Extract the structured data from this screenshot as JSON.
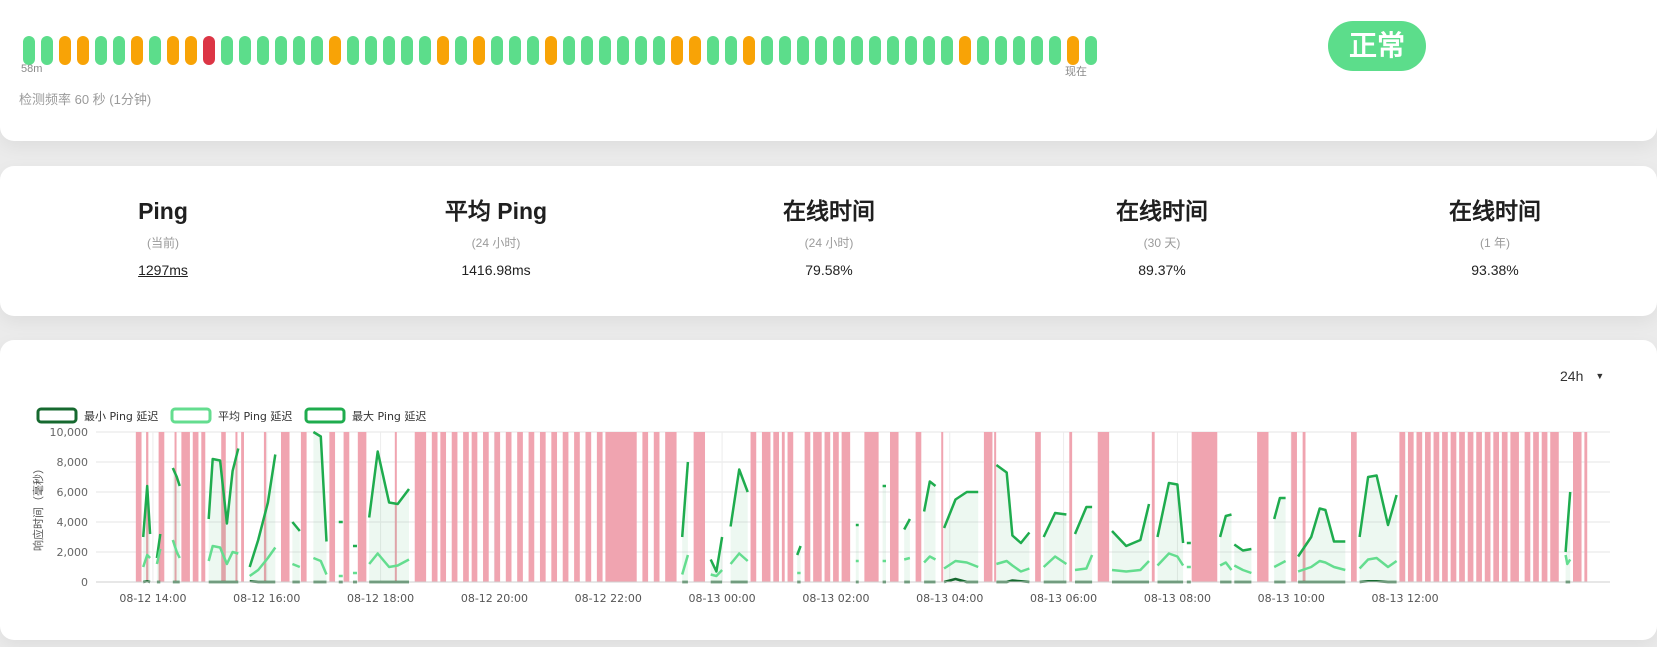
{
  "heartbeat": {
    "beats": [
      "up",
      "up",
      "pending",
      "pending",
      "up",
      "up",
      "pending",
      "up",
      "pending",
      "pending",
      "down",
      "up",
      "up",
      "up",
      "up",
      "up",
      "up",
      "pending",
      "up",
      "up",
      "up",
      "up",
      "up",
      "pending",
      "up",
      "pending",
      "up",
      "up",
      "up",
      "pending",
      "up",
      "up",
      "up",
      "up",
      "up",
      "up",
      "pending",
      "pending",
      "up",
      "up",
      "pending",
      "up",
      "up",
      "up",
      "up",
      "up",
      "up",
      "up",
      "up",
      "up",
      "up",
      "up",
      "pending",
      "up",
      "up",
      "up",
      "up",
      "up",
      "pending",
      "up"
    ],
    "label_start": "58m",
    "label_end": "现在",
    "check_frequency": "检测频率 60 秒 (1分钟)",
    "status": "正常"
  },
  "colors": {
    "up": "#5cdd8b",
    "pending": "#f8a306",
    "down": "#dc3545",
    "down_band": "#f0a4b0",
    "min_line": "#16692f",
    "avg_line": "#64dd8f",
    "max_line": "#1fac4e"
  },
  "stats": [
    {
      "title": "Ping",
      "subtitle": "(当前)",
      "value": "1297ms"
    },
    {
      "title": "平均 Ping",
      "subtitle": "(24 小时)",
      "value": "1416.98ms"
    },
    {
      "title": "在线时间",
      "subtitle": "(24 小时)",
      "value": "79.58%"
    },
    {
      "title": "在线时间",
      "subtitle": "(30 天)",
      "value": "89.37%"
    },
    {
      "title": "在线时间",
      "subtitle": "(1 年)",
      "value": "93.38%"
    }
  ],
  "chart": {
    "range_select": "24h",
    "legend": [
      "最小 Ping 延迟",
      "平均 Ping 延迟",
      "最大 Ping 延迟"
    ]
  },
  "chart_data": {
    "type": "line",
    "ylabel": "响应时间（毫秒）",
    "ylim": [
      0,
      10000
    ],
    "y_ticks": [
      "10,000",
      "8,000",
      "6,000",
      "4,000",
      "2,000",
      "0"
    ],
    "x_ticks": [
      "08-12 14:00",
      "08-12 16:00",
      "08-12 18:00",
      "08-12 20:00",
      "08-12 22:00",
      "08-13 00:00",
      "08-13 02:00",
      "08-13 04:00",
      "08-13 06:00",
      "08-13 08:00",
      "08-13 10:00",
      "08-13 12:00"
    ],
    "x_start": "08-12 14:00",
    "x_tick_hours": 2,
    "segments": [
      {
        "x": [
          13.83,
          13.9,
          13.95
        ],
        "min": [
          0,
          50,
          0
        ],
        "avg": [
          1000,
          1800,
          1600
        ],
        "max": [
          3000,
          6400,
          3200
        ]
      },
      {
        "x": [
          14.07,
          14.13
        ],
        "min": [
          0,
          0
        ],
        "avg": [
          1200,
          2200
        ],
        "max": [
          1600,
          3200
        ]
      },
      {
        "x": [
          14.35,
          14.42,
          14.47
        ],
        "min": [
          0,
          0,
          0
        ],
        "avg": [
          2800,
          2000,
          1600
        ],
        "max": [
          7600,
          7000,
          6400
        ]
      },
      {
        "x": [
          14.98,
          15.05,
          15.18,
          15.3,
          15.4,
          15.5
        ],
        "min": [
          0,
          0,
          0,
          0,
          0,
          0
        ],
        "avg": [
          1400,
          2400,
          2300,
          1200,
          2000,
          1900
        ],
        "max": [
          4200,
          8200,
          8100,
          3900,
          7400,
          8900
        ]
      },
      {
        "x": [
          15.7,
          15.85,
          16.02,
          16.15
        ],
        "min": [
          50,
          0,
          0,
          0
        ],
        "avg": [
          400,
          800,
          1600,
          2300
        ],
        "max": [
          1000,
          2800,
          5300,
          8500
        ]
      },
      {
        "x": [
          16.45,
          16.58
        ],
        "min": [
          0,
          0
        ],
        "avg": [
          1200,
          1000
        ],
        "max": [
          4000,
          3400
        ]
      },
      {
        "x": [
          16.82,
          16.95,
          17.05
        ],
        "min": [
          0,
          0,
          0
        ],
        "avg": [
          1600,
          1400,
          500
        ],
        "max": [
          10000,
          9700,
          2700
        ]
      },
      {
        "x": [
          17.3
        ],
        "min": [
          0
        ],
        "avg": [
          400
        ],
        "max": [
          4000
        ]
      },
      {
        "x": [
          17.55
        ],
        "min": [
          0
        ],
        "avg": [
          600
        ],
        "max": [
          2400
        ]
      },
      {
        "x": [
          17.8,
          17.95,
          18.15,
          18.3,
          18.5
        ],
        "min": [
          0,
          0,
          0,
          0,
          0
        ],
        "avg": [
          1200,
          1900,
          1000,
          1100,
          1500
        ],
        "max": [
          4300,
          8700,
          5300,
          5200,
          6200
        ]
      },
      {
        "x": [
          23.3,
          23.4
        ],
        "min": [
          0,
          0
        ],
        "avg": [
          500,
          1800
        ],
        "max": [
          3000,
          8000
        ]
      },
      {
        "x": [
          23.8,
          23.9,
          24.0
        ],
        "min": [
          0,
          0,
          0
        ],
        "avg": [
          500,
          400,
          800
        ],
        "max": [
          1500,
          700,
          3000
        ]
      },
      {
        "x": [
          24.15,
          24.3,
          24.45
        ],
        "min": [
          0,
          0,
          0
        ],
        "avg": [
          1200,
          1900,
          1400
        ],
        "max": [
          3700,
          7500,
          6000
        ]
      },
      {
        "x": [
          25.32,
          25.38
        ],
        "min": [
          0,
          0
        ],
        "avg": [
          600,
          600
        ],
        "max": [
          1800,
          2400
        ]
      },
      {
        "x": [
          26.35,
          26.4
        ],
        "min": [
          0,
          0
        ],
        "avg": [
          1400,
          1400
        ],
        "max": [
          3800,
          3800
        ]
      },
      {
        "x": [
          26.82,
          26.88
        ],
        "min": [
          0,
          0
        ],
        "avg": [
          1400,
          1400
        ],
        "max": [
          6400,
          6400
        ]
      },
      {
        "x": [
          27.2,
          27.3
        ],
        "min": [
          0,
          0
        ],
        "avg": [
          1500,
          1600
        ],
        "max": [
          3500,
          4200
        ]
      },
      {
        "x": [
          27.55,
          27.65,
          27.75
        ],
        "min": [
          0,
          0,
          0
        ],
        "avg": [
          1300,
          1700,
          1500
        ],
        "max": [
          4700,
          6700,
          6400
        ]
      },
      {
        "x": [
          27.9,
          28.1,
          28.3,
          28.5
        ],
        "min": [
          0,
          200,
          0,
          0
        ],
        "avg": [
          900,
          1400,
          1300,
          1000
        ],
        "max": [
          3600,
          5500,
          6000,
          6000
        ]
      },
      {
        "x": [
          28.82,
          29.0,
          29.1,
          29.25,
          29.4
        ],
        "min": [
          0,
          0,
          100,
          50,
          0
        ],
        "avg": [
          1200,
          1400,
          1100,
          700,
          900
        ],
        "max": [
          7800,
          7300,
          3100,
          2600,
          3300
        ]
      },
      {
        "x": [
          29.65,
          29.85,
          30.05
        ],
        "min": [
          0,
          0,
          0
        ],
        "avg": [
          1000,
          1700,
          1200
        ],
        "max": [
          3000,
          4600,
          4500
        ]
      },
      {
        "x": [
          30.2,
          30.4,
          30.5
        ],
        "min": [
          0,
          0,
          0
        ],
        "avg": [
          800,
          900,
          1800
        ],
        "max": [
          3200,
          5000,
          5000
        ]
      },
      {
        "x": [
          30.85,
          31.1,
          31.35,
          31.5
        ],
        "min": [
          0,
          0,
          0,
          0
        ],
        "avg": [
          800,
          700,
          800,
          1400
        ],
        "max": [
          3400,
          2400,
          2800,
          5200
        ]
      },
      {
        "x": [
          31.65,
          31.85,
          32.0,
          32.1
        ],
        "min": [
          0,
          0,
          0,
          0
        ],
        "avg": [
          1100,
          1900,
          1700,
          1100
        ],
        "max": [
          3000,
          6600,
          6500,
          2600
        ]
      },
      {
        "x": [
          32.2
        ],
        "min": [
          0
        ],
        "avg": [
          1000
        ],
        "max": [
          2600
        ]
      },
      {
        "x": [
          32.75,
          32.85,
          32.95
        ],
        "min": [
          0,
          0,
          0
        ],
        "avg": [
          1100,
          1300,
          800
        ],
        "max": [
          3000,
          4400,
          4500
        ]
      },
      {
        "x": [
          33.0,
          33.15,
          33.3
        ],
        "min": [
          0,
          0,
          0
        ],
        "avg": [
          1100,
          800,
          600
        ],
        "max": [
          2500,
          2100,
          2200
        ]
      },
      {
        "x": [
          33.7,
          33.8,
          33.9
        ],
        "min": [
          0,
          0,
          0
        ],
        "avg": [
          1000,
          1200,
          1400
        ],
        "max": [
          4200,
          5600,
          5600
        ]
      },
      {
        "x": [
          34.12,
          34.35,
          34.5,
          34.6,
          34.75,
          34.95
        ],
        "min": [
          0,
          0,
          0,
          0,
          0,
          0
        ],
        "avg": [
          700,
          1000,
          1400,
          1300,
          1000,
          800
        ],
        "max": [
          1700,
          3000,
          4900,
          4800,
          2700,
          2700
        ]
      },
      {
        "x": [
          35.2,
          35.35,
          35.5,
          35.7,
          35.85
        ],
        "min": [
          0,
          50,
          50,
          0,
          0
        ],
        "avg": [
          900,
          1500,
          1600,
          1000,
          1400
        ],
        "max": [
          3000,
          7000,
          7100,
          3800,
          5800
        ]
      },
      {
        "x": [
          38.82,
          38.85,
          38.9
        ],
        "min": [
          0,
          0,
          0
        ],
        "avg": [
          1800,
          1200,
          1500
        ],
        "max": [
          2000,
          3500,
          6000
        ]
      }
    ],
    "down_intervals": [
      [
        13.7,
        13.8
      ],
      [
        13.88,
        13.92
      ],
      [
        14.1,
        14.2
      ],
      [
        14.38,
        14.4
      ],
      [
        14.5,
        14.65
      ],
      [
        14.7,
        14.8
      ],
      [
        14.85,
        14.92
      ],
      [
        15.2,
        15.28
      ],
      [
        15.45,
        15.48
      ],
      [
        15.55,
        15.6
      ],
      [
        15.95,
        15.99
      ],
      [
        16.25,
        16.4
      ],
      [
        16.6,
        16.7
      ],
      [
        17.1,
        17.2
      ],
      [
        17.35,
        17.45
      ],
      [
        17.6,
        17.75
      ],
      [
        18.25,
        18.28
      ],
      [
        18.6,
        18.8
      ],
      [
        18.9,
        19.0
      ],
      [
        19.05,
        19.15
      ],
      [
        19.25,
        19.35
      ],
      [
        19.45,
        19.55
      ],
      [
        19.6,
        19.7
      ],
      [
        19.8,
        19.9
      ],
      [
        20.0,
        20.1
      ],
      [
        20.2,
        20.3
      ],
      [
        20.4,
        20.5
      ],
      [
        20.6,
        20.7
      ],
      [
        20.8,
        20.9
      ],
      [
        21.0,
        21.1
      ],
      [
        21.2,
        21.3
      ],
      [
        21.4,
        21.5
      ],
      [
        21.6,
        21.7
      ],
      [
        21.8,
        21.9
      ],
      [
        21.95,
        22.5
      ],
      [
        22.6,
        22.7
      ],
      [
        22.8,
        22.9
      ],
      [
        23.0,
        23.2
      ],
      [
        23.5,
        23.7
      ],
      [
        24.5,
        24.6
      ],
      [
        24.7,
        24.85
      ],
      [
        24.9,
        25.0
      ],
      [
        25.05,
        25.1
      ],
      [
        25.15,
        25.25
      ],
      [
        25.45,
        25.55
      ],
      [
        25.6,
        25.75
      ],
      [
        25.8,
        25.9
      ],
      [
        25.95,
        26.05
      ],
      [
        26.1,
        26.25
      ],
      [
        26.5,
        26.75
      ],
      [
        26.95,
        27.1
      ],
      [
        27.4,
        27.5
      ],
      [
        27.85,
        27.88
      ],
      [
        28.6,
        28.75
      ],
      [
        28.78,
        28.8
      ],
      [
        29.5,
        29.6
      ],
      [
        30.1,
        30.15
      ],
      [
        30.6,
        30.8
      ],
      [
        31.55,
        31.6
      ],
      [
        32.25,
        32.7
      ],
      [
        33.4,
        33.6
      ],
      [
        34.0,
        34.1
      ],
      [
        34.2,
        34.25
      ],
      [
        35.05,
        35.15
      ],
      [
        35.9,
        36.0
      ],
      [
        36.05,
        36.15
      ],
      [
        36.2,
        36.3
      ],
      [
        36.35,
        36.45
      ],
      [
        36.5,
        36.6
      ],
      [
        36.65,
        36.75
      ],
      [
        36.8,
        36.9
      ],
      [
        36.95,
        37.05
      ],
      [
        37.1,
        37.2
      ],
      [
        37.25,
        37.35
      ],
      [
        37.4,
        37.5
      ],
      [
        37.55,
        37.65
      ],
      [
        37.7,
        37.8
      ],
      [
        37.85,
        38.0
      ],
      [
        38.1,
        38.2
      ],
      [
        38.25,
        38.35
      ],
      [
        38.4,
        38.5
      ],
      [
        38.55,
        38.7
      ],
      [
        38.95,
        39.1
      ],
      [
        39.15,
        39.2
      ]
    ]
  }
}
